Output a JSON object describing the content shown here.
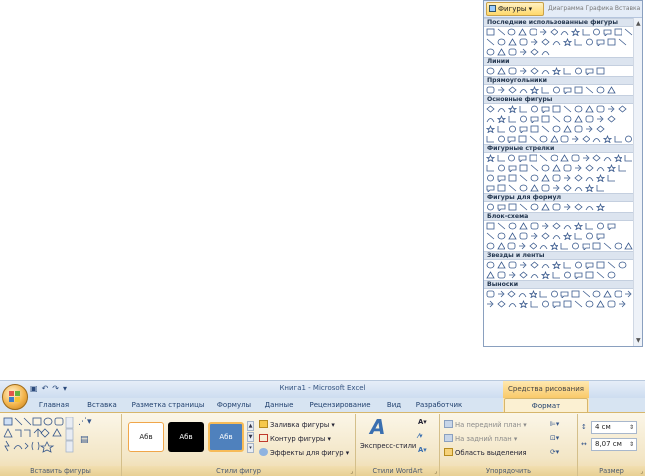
{
  "gallery": {
    "button_label": "Фигуры",
    "peek_text": "Диаграмма  Графика  Вставка",
    "sections": [
      {
        "title": "Последние использованные фигуры",
        "rows": 3
      },
      {
        "title": "Линии",
        "rows": 1
      },
      {
        "title": "Прямоугольники",
        "rows": 1
      },
      {
        "title": "Основные фигуры",
        "rows": 4
      },
      {
        "title": "Фигурные стрелки",
        "rows": 4
      },
      {
        "title": "Фигуры для формул",
        "rows": 1
      },
      {
        "title": "Блок-схема",
        "rows": 3
      },
      {
        "title": "Звезды и ленты",
        "rows": 2
      },
      {
        "title": "Выноски",
        "rows": 2
      }
    ]
  },
  "excel": {
    "window_title": "Книга1 - Microsoft Excel",
    "context_title": "Средства рисования",
    "tabs": [
      "Главная",
      "Вставка",
      "Разметка страницы",
      "Формулы",
      "Данные",
      "Рецензирование",
      "Вид",
      "Разработчик",
      "Формат"
    ],
    "active_tab": "Формат",
    "groups": {
      "insert_shapes": "Вставить фигуры",
      "shape_styles": "Стили фигур",
      "wordart_styles": "Стили WordArt",
      "arrange": "Упорядочить",
      "size": "Размер"
    },
    "style_samples": [
      "Абв",
      "Абв",
      "Абв"
    ],
    "shape_commands": {
      "fill": "Заливка фигуры",
      "outline": "Контур фигуры",
      "effects": "Эффекты для фигур"
    },
    "express_styles": "Экспресс-стили",
    "arrange_commands": {
      "bring_front": "На передний план",
      "send_back": "На задний план",
      "selection_pane": "Область выделения"
    },
    "size": {
      "height": "4 см",
      "width": "8,07 см"
    },
    "colors": {
      "accent": "#4f81bd",
      "context_tab": "#f9c96a",
      "ribbon": "#f3e6c6"
    }
  }
}
